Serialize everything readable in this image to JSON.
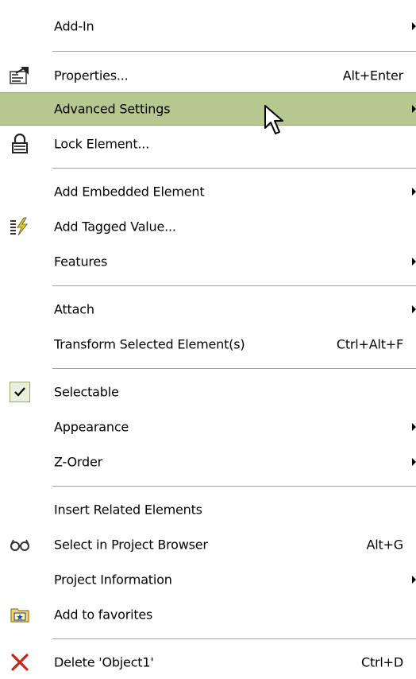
{
  "menu": {
    "items": [
      {
        "label": "Add-In",
        "shortcut": "",
        "submenu": true
      },
      {
        "label": "Properties...",
        "shortcut": "Alt+Enter",
        "submenu": false,
        "icon": "properties-icon"
      },
      {
        "label": "Advanced Settings",
        "shortcut": "",
        "submenu": true,
        "highlighted": true
      },
      {
        "label": "Lock Element...",
        "shortcut": "",
        "submenu": false,
        "icon": "lock-icon"
      },
      {
        "label": "Add Embedded Element",
        "shortcut": "",
        "submenu": true
      },
      {
        "label": "Add Tagged Value...",
        "shortcut": "",
        "submenu": false,
        "icon": "tagged-value-icon"
      },
      {
        "label": "Features",
        "shortcut": "",
        "submenu": true
      },
      {
        "label": "Attach",
        "shortcut": "",
        "submenu": true
      },
      {
        "label": "Transform Selected Element(s)",
        "shortcut": "Ctrl+Alt+F",
        "submenu": false
      },
      {
        "label": "Selectable",
        "shortcut": "",
        "submenu": false,
        "checked": true
      },
      {
        "label": "Appearance",
        "shortcut": "",
        "submenu": true
      },
      {
        "label": "Z-Order",
        "shortcut": "",
        "submenu": true
      },
      {
        "label": "Insert Related Elements",
        "shortcut": "",
        "submenu": false
      },
      {
        "label": "Select in Project Browser",
        "shortcut": "Alt+G",
        "submenu": false,
        "icon": "glasses-icon"
      },
      {
        "label": "Project Information",
        "shortcut": "",
        "submenu": true
      },
      {
        "label": "Add to favorites",
        "shortcut": "",
        "submenu": false,
        "icon": "favorites-folder-icon"
      },
      {
        "label": "Delete 'Object1'",
        "shortcut": "Ctrl+D",
        "submenu": false,
        "icon": "delete-icon"
      }
    ]
  },
  "colors": {
    "highlight": "#b6c790",
    "highlight_border": "#95a86b",
    "separator": "#a0a0a0"
  }
}
